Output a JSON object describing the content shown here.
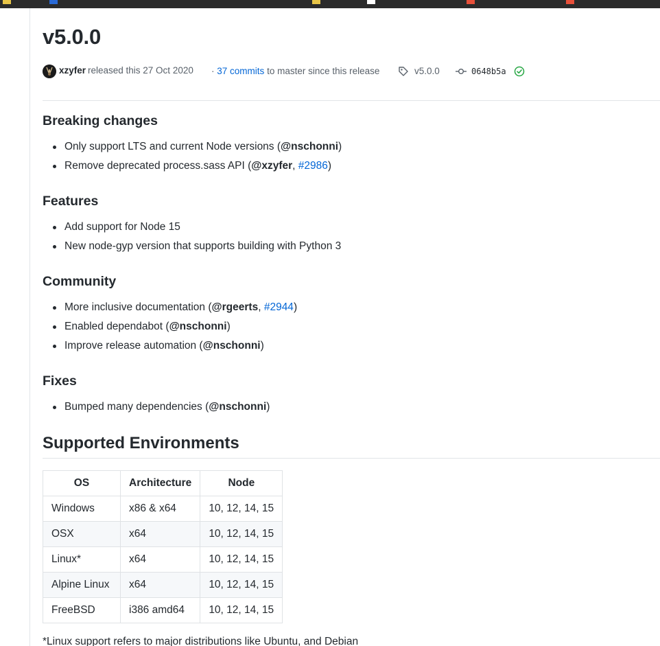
{
  "release": {
    "title": "v5.0.0",
    "author": "xzyfer",
    "released_text": "released this 27 Oct 2020",
    "commits_prefix": "·",
    "commits_link": "37 commits",
    "commits_suffix": "to master since this release",
    "tag": "v5.0.0",
    "commit_sha": "0648b5a"
  },
  "sections": [
    {
      "heading": "Breaking changes",
      "items": [
        {
          "text": "Only support LTS and current Node versions (",
          "mention": "@nschonni",
          "sep": "",
          "issue": "",
          "close": ")"
        },
        {
          "text": "Remove deprecated process.sass API (",
          "mention": "@xzyfer",
          "sep": ", ",
          "issue": "#2986",
          "close": ")"
        }
      ]
    },
    {
      "heading": "Features",
      "items": [
        {
          "text": "Add support for Node 15"
        },
        {
          "text": "New node-gyp version that supports building with Python 3"
        }
      ]
    },
    {
      "heading": "Community",
      "items": [
        {
          "text": "More inclusive documentation (",
          "mention": "@rgeerts",
          "sep": ", ",
          "issue": "#2944",
          "close": ")"
        },
        {
          "text": "Enabled dependabot (",
          "mention": "@nschonni",
          "close": ")"
        },
        {
          "text": "Improve release automation (",
          "mention": "@nschonni",
          "close": ")"
        }
      ]
    },
    {
      "heading": "Fixes",
      "items": [
        {
          "text": "Bumped many dependencies (",
          "mention": "@nschonni",
          "close": ")"
        }
      ]
    }
  ],
  "environments": {
    "heading": "Supported Environments",
    "headers": [
      "OS",
      "Architecture",
      "Node"
    ],
    "rows": [
      [
        "Windows",
        "x86 & x64",
        "10, 12, 14, 15"
      ],
      [
        "OSX",
        "x64",
        "10, 12, 14, 15"
      ],
      [
        "Linux*",
        "x64",
        "10, 12, 14, 15"
      ],
      [
        "Alpine Linux",
        "x64",
        "10, 12, 14, 15"
      ],
      [
        "FreeBSD",
        "i386 amd64",
        "10, 12, 14, 15"
      ]
    ],
    "footnote": "*Linux support refers to major distributions like Ubuntu, and Debian"
  },
  "colors": {
    "link": "#0366d6",
    "success": "#28a745",
    "text": "#24292e",
    "muted": "#586069"
  }
}
